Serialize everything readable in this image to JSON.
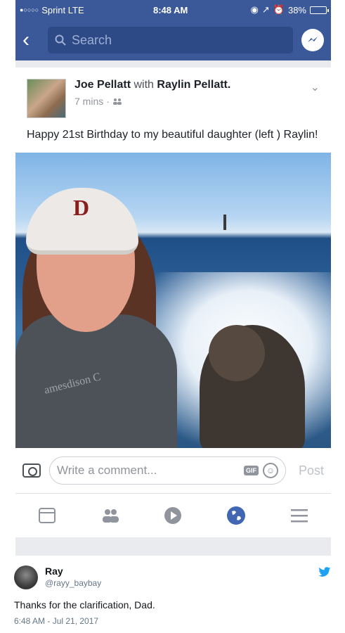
{
  "status_bar": {
    "signal": "●○○○○",
    "carrier": "Sprint  LTE",
    "time": "8:48 AM",
    "battery": "38%",
    "battery_level": 0.38
  },
  "nav": {
    "search_placeholder": "Search"
  },
  "post": {
    "author": "Joe Pellatt",
    "with_text": "with",
    "tagged": "Raylin Pellatt.",
    "time": "7 mins",
    "separator": "·",
    "text": "Happy 21st Birthday to my beautiful daughter (left ) Raylin!",
    "cap_letter": "D",
    "shirt_text": "amesdison C"
  },
  "comment_bar": {
    "placeholder": "Write a comment...",
    "gif": "GIF",
    "post_label": "Post"
  },
  "tabs": [
    "news-feed",
    "friends",
    "watch",
    "globe",
    "menu"
  ],
  "tweet": {
    "name": "Ray",
    "handle": "@rayy_baybay",
    "text": "Thanks for the clarification, Dad.",
    "timestamp": "6:48 AM - Jul 21, 2017"
  },
  "colors": {
    "facebook_blue": "#3b5998",
    "twitter_blue": "#1da1f2"
  }
}
